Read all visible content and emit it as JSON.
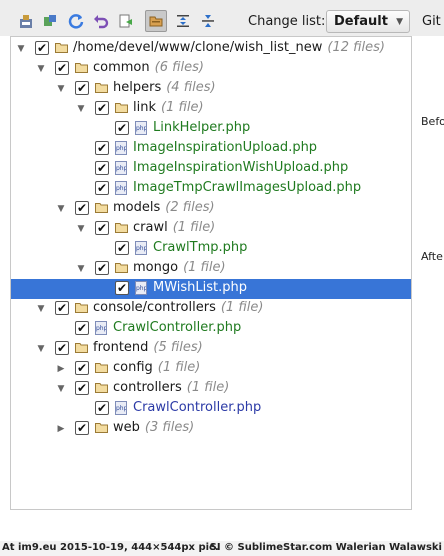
{
  "toolbar": {
    "buttons": [
      {
        "name": "commit-icon"
      },
      {
        "name": "shelve-icon"
      },
      {
        "name": "refresh-icon"
      },
      {
        "name": "rollback-icon"
      },
      {
        "name": "show-diff-icon"
      },
      {
        "name": "group-by-directory-icon"
      },
      {
        "name": "expand-all-icon"
      },
      {
        "name": "collapse-all-icon"
      }
    ],
    "change_list_label": "Change list:",
    "change_list_value": "Default",
    "git_label": "Git"
  },
  "tree": [
    {
      "label": "/home/devel/www/clone/wish_list_new",
      "count": "(12 files)"
    },
    {
      "label": "common",
      "count": "(6 files)"
    },
    {
      "label": "helpers",
      "count": "(4 files)"
    },
    {
      "label": "link",
      "count": "(1 file)"
    },
    {
      "label": "LinkHelper.php",
      "count": ""
    },
    {
      "label": "ImageInspirationUpload.php",
      "count": ""
    },
    {
      "label": "ImageInspirationWishUpload.php",
      "count": ""
    },
    {
      "label": "ImageTmpCrawlImagesUpload.php",
      "count": ""
    },
    {
      "label": "models",
      "count": "(2 files)"
    },
    {
      "label": "crawl",
      "count": "(1 file)"
    },
    {
      "label": "CrawlTmp.php",
      "count": ""
    },
    {
      "label": "mongo",
      "count": "(1 file)"
    },
    {
      "label": "MWishList.php",
      "count": ""
    },
    {
      "label": "console/controllers",
      "count": "(1 file)"
    },
    {
      "label": "CrawlController.php",
      "count": ""
    },
    {
      "label": "frontend",
      "count": "(5 files)"
    },
    {
      "label": "config",
      "count": "(1 file)"
    },
    {
      "label": "controllers",
      "count": "(1 file)"
    },
    {
      "label": "CrawlController.php",
      "count": ""
    },
    {
      "label": "web",
      "count": "(3 files)"
    }
  ],
  "side": {
    "before": "Befo",
    "after": "Afte"
  },
  "php_icon_text": "php",
  "check_mark": "✔",
  "arrow_open": "▼",
  "arrow_closed": "▶",
  "footer": {
    "left": "At im9.eu 2015-10-19, 444×544px pic.",
    "right": "SI © SublimeStar.com Walerian Walawski"
  },
  "colors": {
    "selection": "#3875d7",
    "added_file": "#1f7a1f",
    "modified_file": "#2b3aa6"
  }
}
